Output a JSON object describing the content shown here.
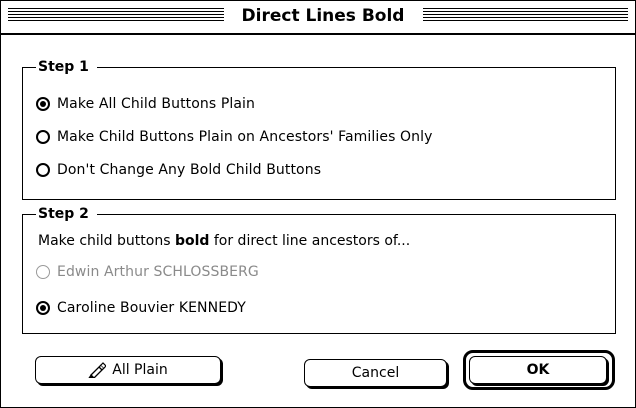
{
  "window": {
    "title": "Direct Lines Bold"
  },
  "step1": {
    "legend": "Step 1",
    "options": [
      {
        "label": "Make All Child Buttons Plain",
        "selected": true
      },
      {
        "label": "Make Child Buttons Plain on Ancestors' Families Only",
        "selected": false
      },
      {
        "label": "Don't Change Any Bold Child Buttons",
        "selected": false
      }
    ]
  },
  "step2": {
    "legend": "Step 2",
    "description_prefix": "Make child buttons ",
    "description_bold": "bold",
    "description_suffix": " for direct line ancestors of...",
    "options": [
      {
        "label": "Edwin Arthur SCHLOSSBERG",
        "selected": false,
        "disabled": true
      },
      {
        "label": "Caroline Bouvier KENNEDY",
        "selected": true,
        "disabled": false
      }
    ]
  },
  "buttons": {
    "all_plain": "All Plain",
    "cancel": "Cancel",
    "ok": "OK"
  },
  "icons": {
    "all_plain_icon": "pencil-icon"
  }
}
